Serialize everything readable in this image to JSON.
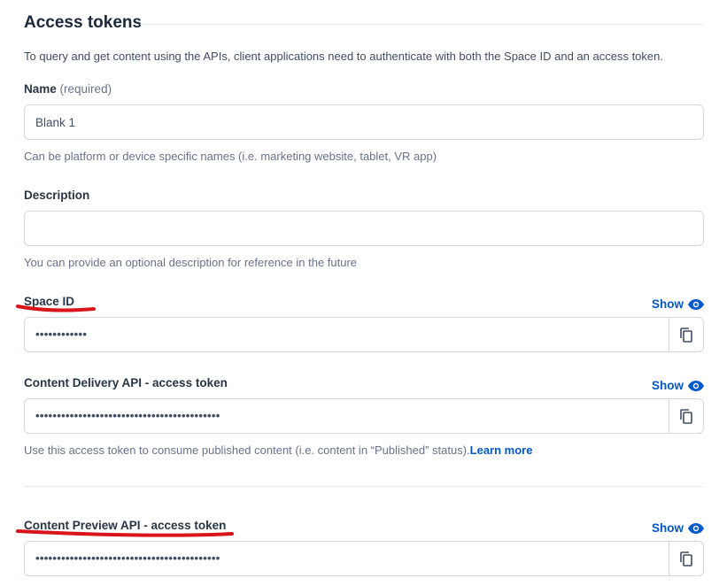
{
  "section": {
    "title": "Access tokens",
    "intro": "To query and get content using the APIs, client applications need to authenticate with both the Space ID and an access token."
  },
  "name_field": {
    "label": "Name",
    "required": "(required)",
    "value": "Blank 1",
    "help": "Can be platform or device specific names (i.e. marketing website, tablet, VR app)"
  },
  "description_field": {
    "label": "Description",
    "value": "",
    "help": "You can provide an optional description for reference in the future"
  },
  "space_id": {
    "label": "Space ID",
    "show_label": "Show",
    "masked": "••••••••••••"
  },
  "delivery_token": {
    "label": "Content Delivery API - access token",
    "show_label": "Show",
    "masked": "•••••••••••••••••••••••••••••••••••••••••••",
    "help": "Use this access token to consume published content (i.e. content in “Published” status).",
    "learn_more": "Learn more"
  },
  "preview_token": {
    "label": "Content Preview API - access token",
    "show_label": "Show",
    "masked": "•••••••••••••••••••••••••••••••••••••••••••"
  },
  "colors": {
    "link": "#0059c8",
    "annotation": "#d9141b",
    "border": "#cfd9e0"
  },
  "icons": [
    "eye-icon",
    "copy-icon"
  ]
}
